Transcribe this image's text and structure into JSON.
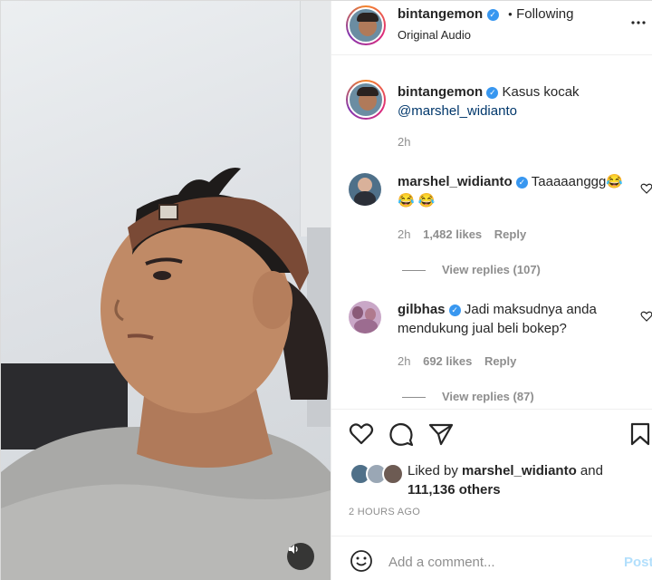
{
  "post": {
    "username": "bintangemon",
    "follow_separator": "•",
    "follow_status": "Following",
    "audio": "Original Audio",
    "more_icon": "more-icon"
  },
  "caption": {
    "username": "bintangemon",
    "text": "Kasus kocak",
    "mention": "@marshel_widianto",
    "time": "2h"
  },
  "comments": [
    {
      "username": "marshel_widianto",
      "text_line1": "Taaaaanggg😂",
      "text_line2": "😂 😂",
      "time": "2h",
      "likes": "1,482 likes",
      "reply": "Reply",
      "view_replies": "View replies (107)"
    },
    {
      "username": "gilbhas",
      "text_line1": "Jadi maksudnya anda",
      "text_line2": "mendukung jual beli bokep?",
      "time": "2h",
      "likes": "692 likes",
      "reply": "Reply",
      "view_replies": "View replies (87)"
    }
  ],
  "liked_by": {
    "prefix": "Liked by",
    "user": "marshel_widianto",
    "and": "and",
    "others": "111,136 others"
  },
  "timestamp": "2 HOURS AGO",
  "comment_input": {
    "placeholder": "Add a comment...",
    "post_label": "Post"
  },
  "icons": {
    "like": "heart-icon",
    "comment": "comment-icon",
    "share": "share-icon",
    "save": "bookmark-icon",
    "volume": "volume-icon",
    "emoji": "emoji-icon"
  },
  "colors": {
    "verified": "#3897f0",
    "link": "#00376b",
    "muted": "#8e8e8e",
    "post_disabled": "#b2dffc"
  }
}
